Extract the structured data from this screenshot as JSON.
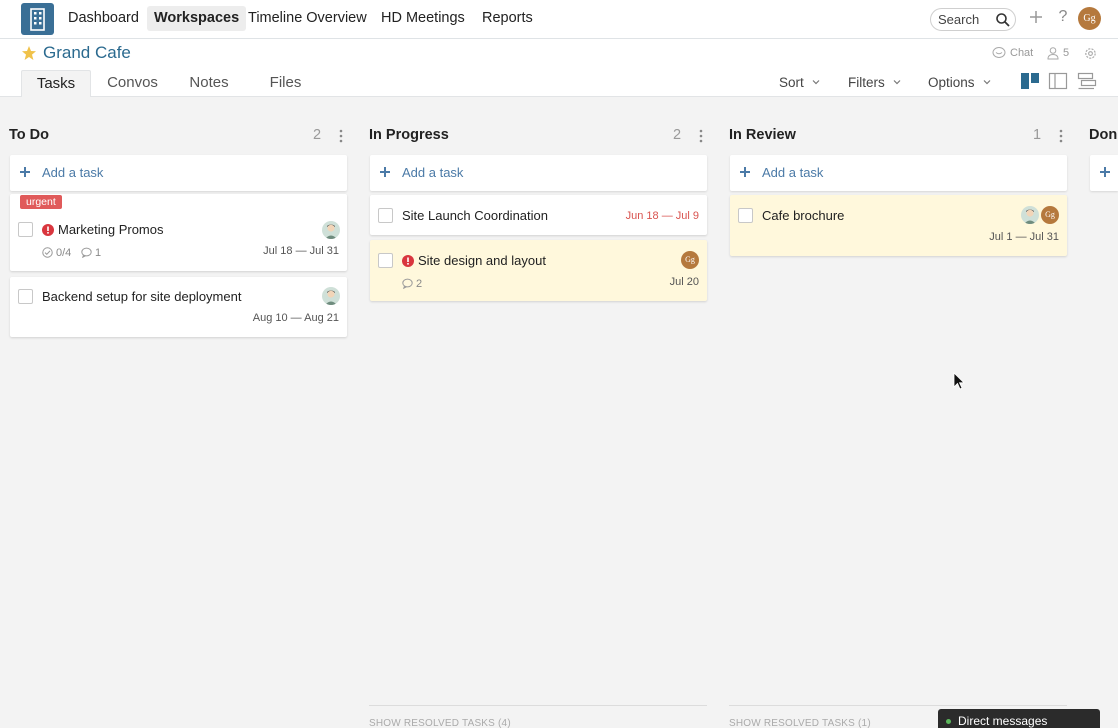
{
  "nav": {
    "links": [
      "Dashboard",
      "Workspaces",
      "Timeline Overview",
      "HD Meetings",
      "Reports"
    ],
    "active": "Workspaces",
    "search_placeholder": "Search",
    "help": "?",
    "user_initials": "Gg"
  },
  "workspace": {
    "title": "Grand Cafe",
    "chat_label": "Chat",
    "member_count": "5",
    "tabs": [
      "Tasks",
      "Convos",
      "Notes",
      "Files"
    ],
    "active_tab": "Tasks",
    "tools": {
      "sort": "Sort",
      "filters": "Filters",
      "options": "Options"
    }
  },
  "board": {
    "add_task_label": "Add a task",
    "columns": [
      {
        "title": "To Do",
        "count": "2",
        "cards": [
          {
            "title": "Marketing Promos",
            "badge": "urgent",
            "urgent": true,
            "checklist": "0/4",
            "comments": "1",
            "dates": "Jul 18 — Jul 31",
            "assignees": [
              "person"
            ]
          },
          {
            "title": "Backend setup for site deployment",
            "dates": "Aug 10 — Aug 21",
            "assignees": [
              "person"
            ]
          }
        ]
      },
      {
        "title": "In Progress",
        "count": "2",
        "cards": [
          {
            "title": "Site Launch Coordination",
            "dates": "Jun 18 — Jul 9",
            "overdue": true
          },
          {
            "title": "Site design and layout",
            "urgent": true,
            "comments": "2",
            "dates": "Jul 20",
            "assignees": [
              "Gg"
            ],
            "highlight": true
          }
        ],
        "resolved_label": "SHOW RESOLVED TASKS (4)"
      },
      {
        "title": "In Review",
        "count": "1",
        "cards": [
          {
            "title": "Cafe brochure",
            "dates": "Jul 1 — Jul 31",
            "assignees": [
              "person",
              "Gg"
            ],
            "highlight": true
          }
        ],
        "resolved_label": "SHOW RESOLVED TASKS (1)"
      },
      {
        "title": "Done",
        "partial_title": "Don"
      }
    ]
  },
  "chat_dock": {
    "label": "Direct messages"
  },
  "colors": {
    "brand": "#3a6f96",
    "title": "#2b6a8f",
    "link": "#4b7aa7",
    "urgent": "#e05a5a",
    "overdue": "#d9534f",
    "highlight": "#fff8dc"
  }
}
